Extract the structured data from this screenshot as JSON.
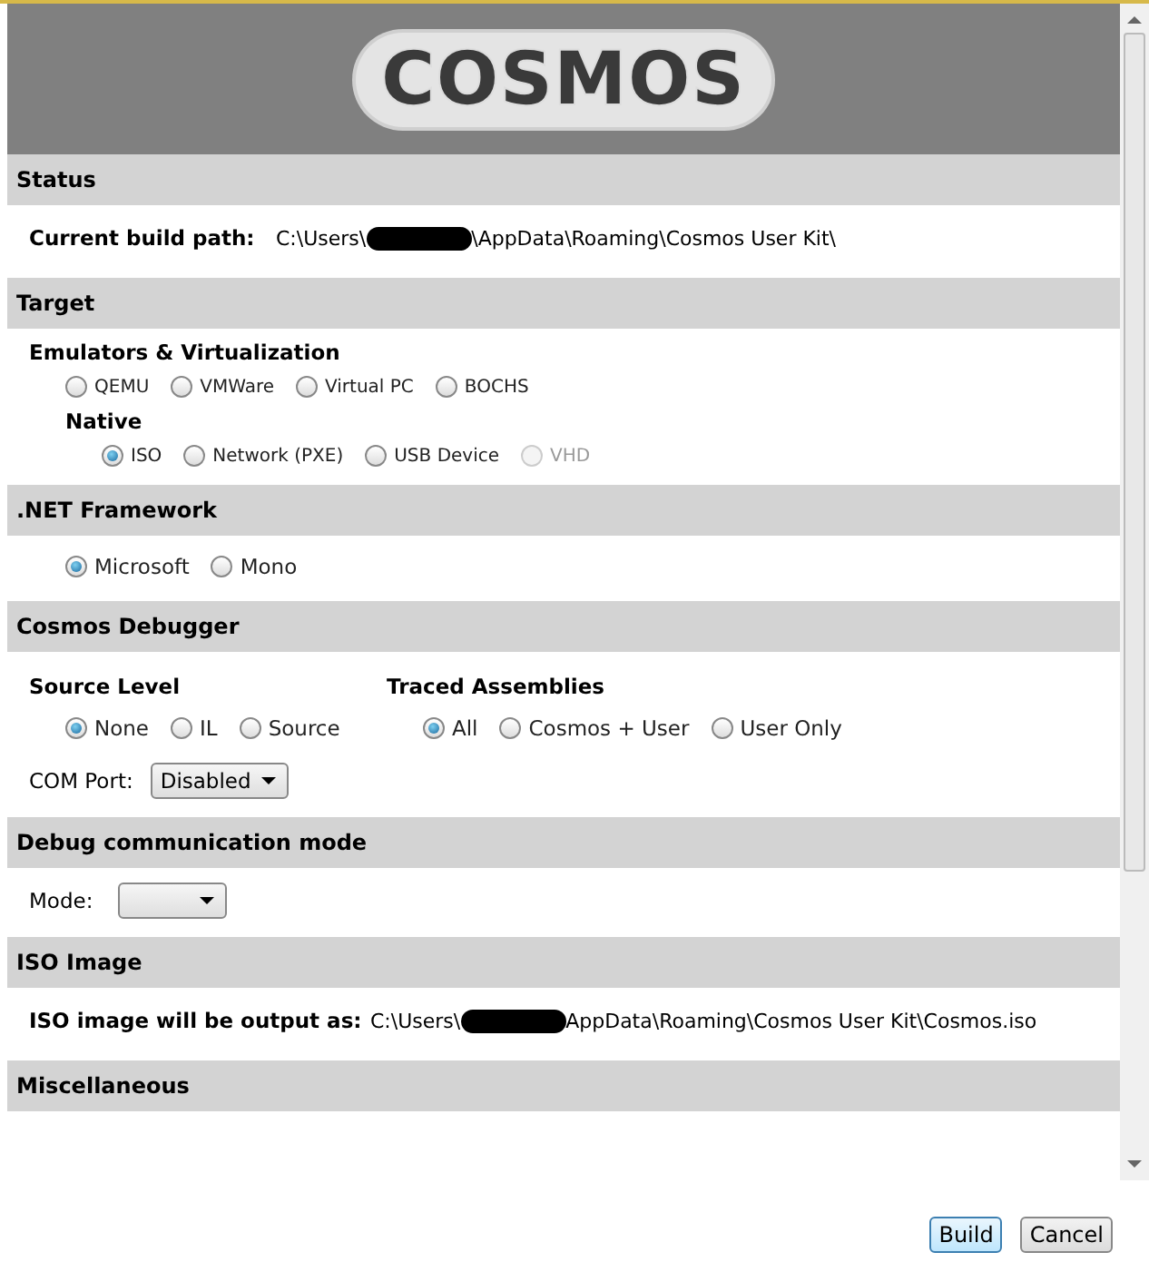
{
  "logo": "COSMOS",
  "sections": [
    {
      "kind": "path",
      "title": "Status",
      "label": "Current build path:",
      "path_before": "C:\\Users\\",
      "path_after": "\\AppData\\Roaming\\Cosmos User Kit\\"
    },
    {
      "kind": "groups",
      "title": "Target",
      "groups": [
        {
          "title": "Emulators & Virtualization",
          "options": [
            {
              "label": "QEMU",
              "selected": false,
              "disabled": false
            },
            {
              "label": "VMWare",
              "selected": false,
              "disabled": false
            },
            {
              "label": "Virtual PC",
              "selected": false,
              "disabled": false
            },
            {
              "label": "BOCHS",
              "selected": false,
              "disabled": false
            }
          ]
        },
        {
          "title": "Native",
          "options": [
            {
              "label": "ISO",
              "selected": true,
              "disabled": false
            },
            {
              "label": "Network (PXE)",
              "selected": false,
              "disabled": false
            },
            {
              "label": "USB Device",
              "selected": false,
              "disabled": false
            },
            {
              "label": "VHD",
              "selected": false,
              "disabled": true
            }
          ]
        }
      ]
    },
    {
      "kind": "radios",
      "title": ".NET Framework",
      "options": [
        {
          "label": "Microsoft",
          "selected": true
        },
        {
          "label": "Mono",
          "selected": false
        }
      ]
    },
    {
      "kind": "debugger",
      "title": "Cosmos Debugger",
      "columns": [
        {
          "title": "Source Level",
          "options": [
            {
              "label": "None",
              "selected": true
            },
            {
              "label": "IL",
              "selected": false
            },
            {
              "label": "Source",
              "selected": false
            }
          ]
        },
        {
          "title": "Traced Assemblies",
          "options": [
            {
              "label": "All",
              "selected": true
            },
            {
              "label": "Cosmos + User",
              "selected": false
            },
            {
              "label": "User Only",
              "selected": false
            }
          ]
        }
      ],
      "field_label": "COM Port:",
      "field_value": "Disabled"
    },
    {
      "kind": "mode",
      "title": "Debug communication mode",
      "field_label": "Mode:"
    },
    {
      "kind": "path",
      "title": "ISO Image",
      "label": "ISO image will be output as:",
      "path_before": "C:\\Users\\",
      "path_after": "AppData\\Roaming\\Cosmos User Kit\\Cosmos.iso"
    },
    {
      "kind": "header",
      "title": "Miscellaneous"
    }
  ],
  "buttons": [
    {
      "label": "Build",
      "selected": true
    },
    {
      "label": "Cancel",
      "selected": false
    }
  ]
}
